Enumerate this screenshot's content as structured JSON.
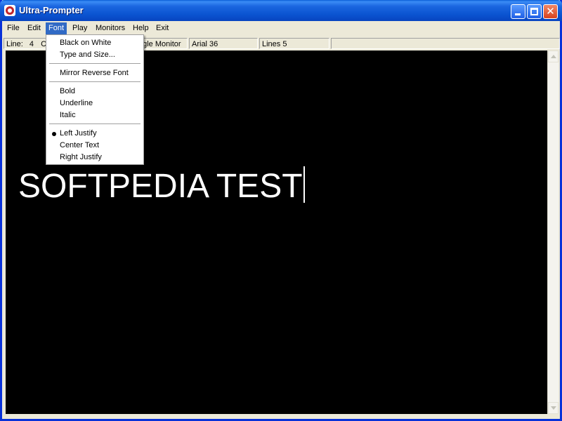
{
  "window": {
    "title": "Ultra-Prompter"
  },
  "menubar": {
    "items": [
      {
        "key": "file",
        "label": "File"
      },
      {
        "key": "edit",
        "label": "Edit"
      },
      {
        "key": "font",
        "label": "Font"
      },
      {
        "key": "play",
        "label": "Play"
      },
      {
        "key": "monitors",
        "label": "Monitors"
      },
      {
        "key": "help",
        "label": "Help"
      },
      {
        "key": "exit",
        "label": "Exit"
      }
    ],
    "active": "Font"
  },
  "status": {
    "line_label": "Line:",
    "line_value": "4",
    "col_label": "C",
    "monitor": "ngle Monitor",
    "font": "Arial 36",
    "lines": "Lines 5"
  },
  "font_menu": {
    "items": [
      {
        "label": "Black on White"
      },
      {
        "label": "Type and Size..."
      },
      {
        "label": "Mirror Reverse Font"
      },
      {
        "label": "Bold"
      },
      {
        "label": "Underline"
      },
      {
        "label": "Italic"
      },
      {
        "label": "Left Justify",
        "checked": true
      },
      {
        "label": "Center Text"
      },
      {
        "label": "Right Justify"
      }
    ]
  },
  "editor": {
    "text": "SOFTPEDIA TEST",
    "background": "#000000",
    "foreground": "#ffffff"
  },
  "colors": {
    "titlebar": "#0a53d0",
    "menu_highlight": "#316ac5",
    "close_button": "#d9431e"
  }
}
